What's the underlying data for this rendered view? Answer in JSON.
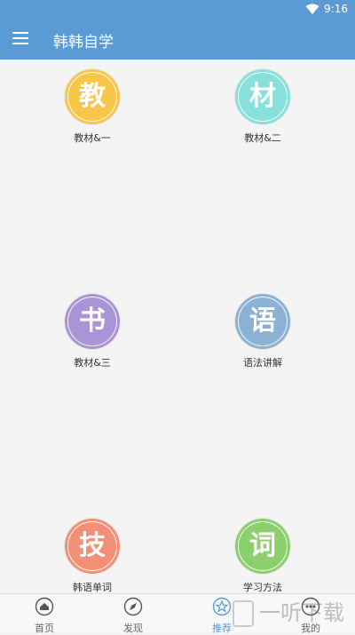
{
  "status_bar": {
    "time": "9:16"
  },
  "app_bar": {
    "title": "韩韩自学"
  },
  "grid": [
    {
      "glyph": "教",
      "label": "教材&一",
      "color": "#f7c64b"
    },
    {
      "glyph": "材",
      "label": "教材&二",
      "color": "#87e0dc"
    },
    {
      "glyph": "书",
      "label": "教材&三",
      "color": "#a994d6"
    },
    {
      "glyph": "语",
      "label": "语法讲解",
      "color": "#8bb1d4"
    },
    {
      "glyph": "技",
      "label": "韩语单词",
      "color": "#f48f77"
    },
    {
      "glyph": "词",
      "label": "学习方法",
      "color": "#8ccf6d"
    }
  ],
  "bottom_nav": [
    {
      "label": "首页",
      "icon": "home-icon"
    },
    {
      "label": "发现",
      "icon": "compass-icon"
    },
    {
      "label": "推荐",
      "icon": "star-icon",
      "active": true
    },
    {
      "label": "我的",
      "icon": "more-icon"
    }
  ],
  "watermark": {
    "text": "一听下载"
  },
  "colors": {
    "primary": "#5b9bd5",
    "background": "#f4f4f4"
  }
}
